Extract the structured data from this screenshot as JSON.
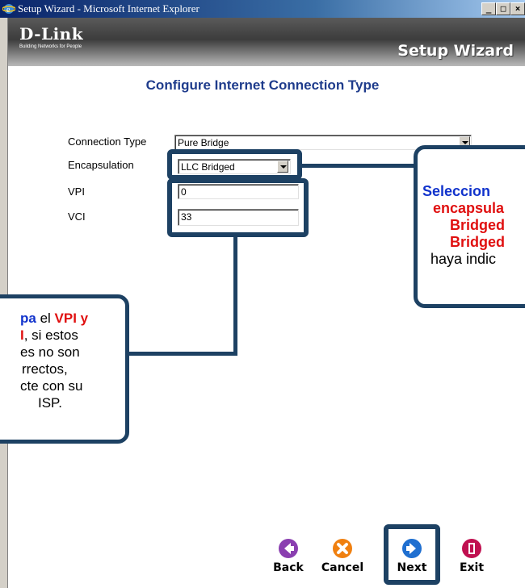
{
  "window": {
    "title": "Setup Wizard - Microsoft Internet Explorer",
    "buttons": [
      "_",
      "□",
      "×"
    ]
  },
  "header": {
    "logo": "D-Link",
    "tagline": "Building Networks for People",
    "title": "Setup Wizard"
  },
  "page": {
    "title": "Configure Internet Connection Type"
  },
  "form": {
    "connection_type_label": "Connection Type",
    "connection_type_value": "Pure Bridge",
    "encapsulation_label": "Encapsulation",
    "encapsulation_value": "LLC Bridged",
    "vpi_label": "VPI",
    "vpi_value": "0",
    "vci_label": "VCI",
    "vci_value": "33"
  },
  "callout_right": {
    "line1": "Seleccion",
    "line2": "encapsula",
    "line3": "Bridged",
    "line4": "Bridged",
    "line5": "haya indic"
  },
  "callout_left": {
    "l1a": "pa",
    "l1b": " el ",
    "l1c": "VPI y",
    "l2a": "I",
    "l2b": ", si estos",
    "l3": "es no son",
    "l4": "rrectos,",
    "l5": "cte con su",
    "l6": "ISP."
  },
  "nav": {
    "back": "Back",
    "cancel": "Cancel",
    "next": "Next",
    "exit": "Exit"
  },
  "colors": {
    "highlight_border": "#1d4163",
    "title_blue": "#1f3c8c",
    "callout_blue": "#1133cc",
    "callout_red": "#e01010"
  }
}
